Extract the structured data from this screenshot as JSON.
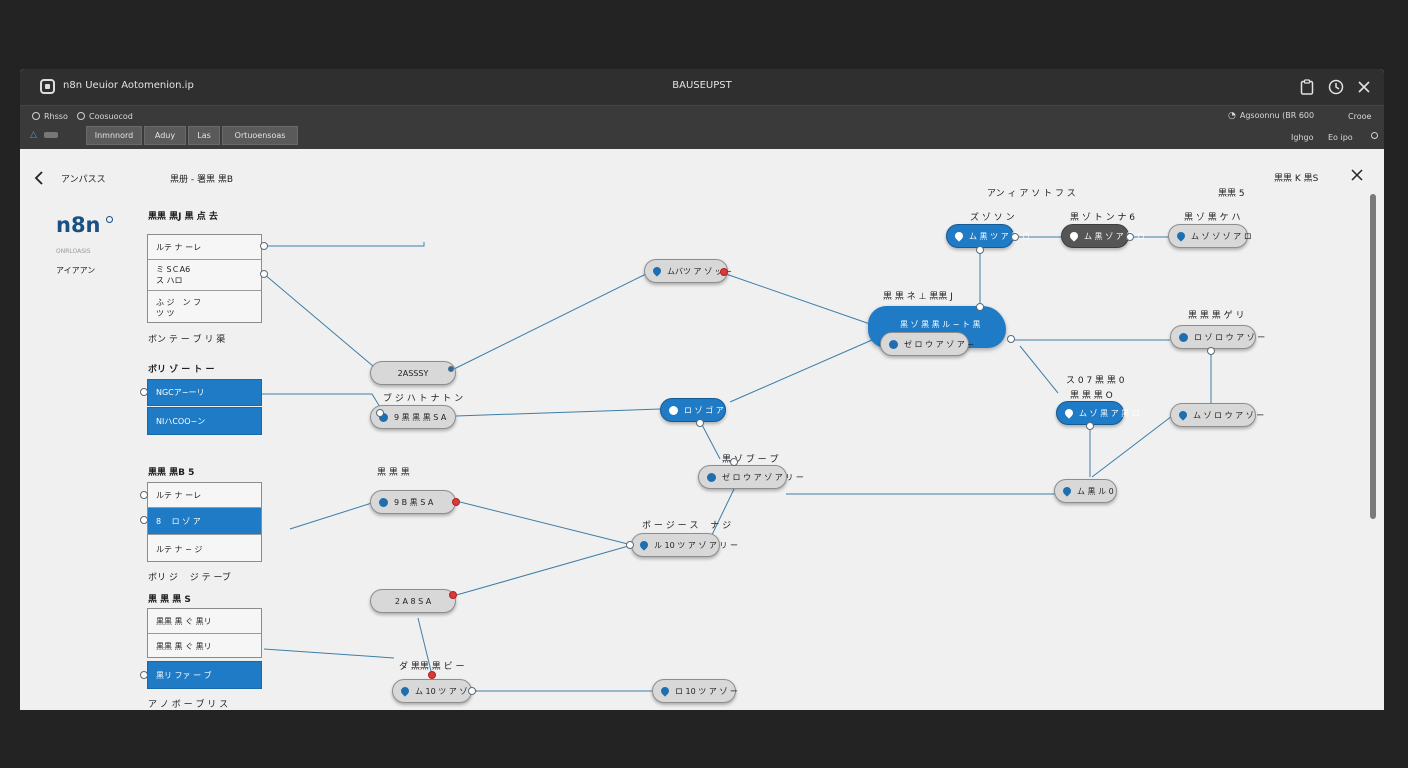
{
  "window": {
    "title": "n8n Ueuior Aotomenion.ip",
    "center_title": "BAUSEUPST"
  },
  "toolbar": {
    "left_items": [
      "Rhsso",
      "Coosuocod"
    ],
    "tabs": [
      "Inmnnord",
      "Aduy",
      "Las",
      "Ortuoensoas"
    ],
    "right_items": [
      "Agsoonnu (BR 600",
      "Crooe",
      "Ighgo",
      "Eo ipo"
    ]
  },
  "header": {
    "back_label": "アンパスス",
    "crumb": "黒册 - 署黒 黒B",
    "top_right_label": "黒黒 K 黒S"
  },
  "sidebar": {
    "logo": "n8n",
    "logo_sub": "ONRLOASIS",
    "logo_sub2": "アイアアン"
  },
  "cards": {
    "c1": {
      "title": "黒黒 黒J 黒 点 去",
      "rows": [
        "ルテ ナ ーレ",
        "ミ SＣA6\nス ハロ",
        "ふ ジ　ン フ\nツ ツ"
      ],
      "footer": "ボン テ ー ブ リ 渠"
    },
    "c2": {
      "title": "ボリ ゾ ー ト ー",
      "rows": [
        "NGCア−ーリ",
        "NIハCOO−ン"
      ]
    },
    "c3": {
      "title": "黒黒 黒B 5",
      "rows": [
        "ルテ ナ ーレ",
        "8 　ロ ゾ ア",
        "ルテ ナ − ジ"
      ],
      "footer": "ボリ ジ 　ジ テ ーブ"
    },
    "c4": {
      "title": "黒 黒 黒 S",
      "rows": [
        "黒黒 黒 ぐ 黒リ",
        "黒黒 黒 ぐ 黒リ",
        "黒リ ファ ー ブ"
      ],
      "footer": "ア ノ ボ ー ブ リ ス"
    }
  },
  "labels": {
    "top_group": "アン ィ ア ソ ト フ ス",
    "top_right": "黒黒 5",
    "n1_title": "ズ ゾ ソ ン",
    "n2_title": "黒 ゾ ト ン ナ 6",
    "n3_title": "黒 ゾ 黒 ケ ハ",
    "hub_title": "黒 黒 ネ ⊥ 黒黒 J",
    "r1_title": "黒 黒 黒 ゲ リ",
    "r2_title": "ス 0 7 黒 黒 0",
    "r2_sub": "黒 黒 黒 O",
    "mid_title": "ブ ジ ハ ト ナ ト ン",
    "dn_title": "黒 ゾ ブ ー プ",
    "lw_title": "黒 黒 黒",
    "bm_title": "ボ ー ジ ー ス 　ナ ジ",
    "bl_title": "ダ 黒黒 黒 ビ ー"
  },
  "nodes": {
    "top1": "ムバツ ア ゾ ッ −",
    "mid1": "2ASSSY",
    "mid2": "9 黒 黒 黒 S A",
    "mid3": "ロ ゾ ゴ ア",
    "center1": "ゼ ロ ウ ア ゾ ア リ ー",
    "left5": "9 B 黒 S A",
    "center2": "ル 10 ツ ア ゾ ア リ ー",
    "left6": "2 A 8 S A",
    "bottom1": "ム 10 ツ ア ゾ ー",
    "bottom2": "ロ 10 ツ ア ゾ ー",
    "hub": "黒 ゾ 黒 黒 ル − ト 黒",
    "hub_sub": "ゼ ロ ウ ア ゾ ア −",
    "top_a": "ム 黒 ツ ア 黒 ロ",
    "top_b": "ム 黒 ゾ ア 黒 ロ",
    "top_c": "ム ゾ ゾ ゾ ア ロ",
    "right1": "ロ ゾ ロ ウ ア ゾ ー",
    "right2": "ム ゾ ロ ウ ア ゾ ー",
    "r_blue": "ム ゾ 黒 ア 黒 ロ",
    "r_bottom": "ム 黒 ル 0"
  },
  "colors": {
    "accent": "#1f7bc6",
    "edge": "#3d7ea8",
    "port_alert": "#d93a3a"
  }
}
